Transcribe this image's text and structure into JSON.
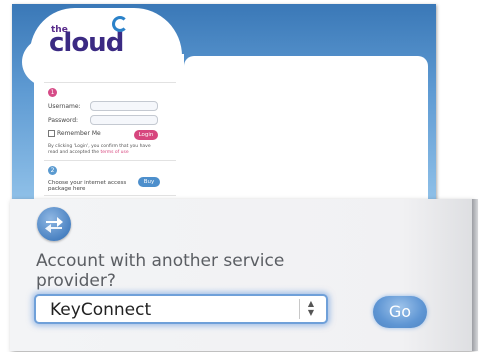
{
  "brand": {
    "small": "the",
    "name": "cloud"
  },
  "login": {
    "step": "1",
    "username_label": "Username:",
    "password_label": "Password:",
    "remember_label": "Remember Me",
    "login_button": "Login",
    "note_prefix": "By clicking 'Login', you confirm that you have read and accepted the",
    "terms_link": "terms of use"
  },
  "buy": {
    "step": "2",
    "text": "Choose your internet access package here",
    "button": "Buy"
  },
  "provider": {
    "question": "Account with another service provider?",
    "selected": "KeyConnect",
    "go_button": "Go"
  },
  "colors": {
    "background_blue": "#5f9bd3",
    "login_pink": "#d7467e",
    "button_blue": "#5f96d4"
  }
}
